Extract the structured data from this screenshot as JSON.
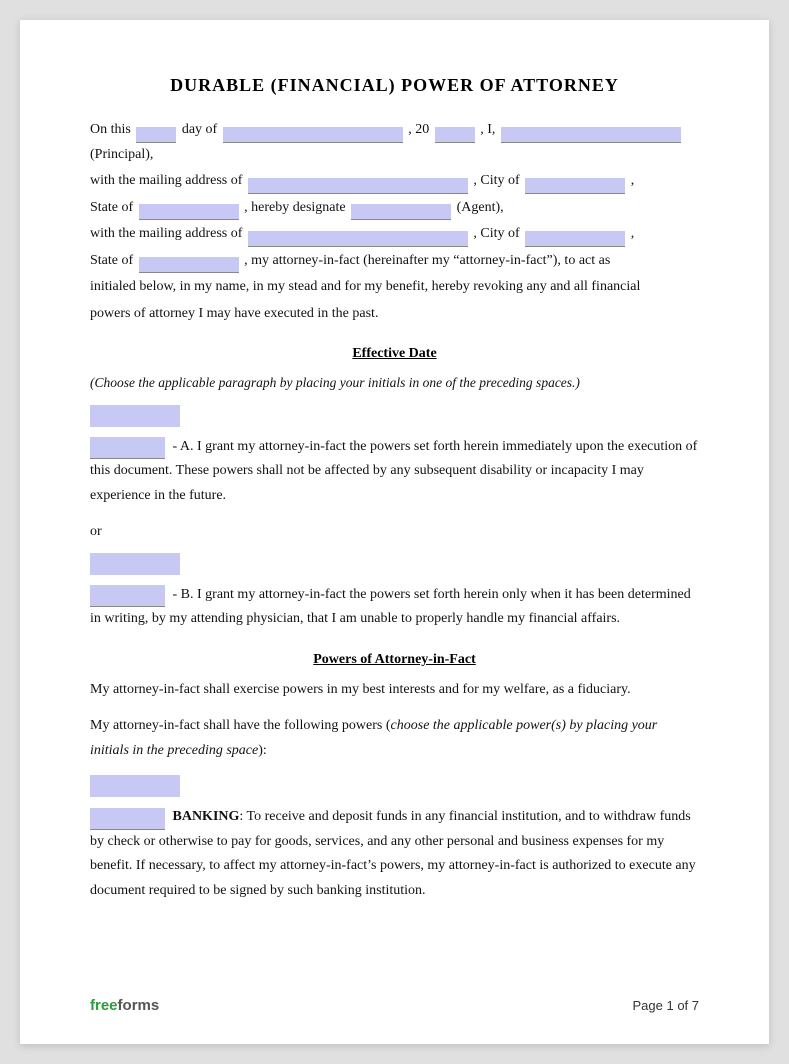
{
  "document": {
    "title": "DURABLE (FINANCIAL) POWER OF ATTORNEY",
    "intro": {
      "line1_prefix": "On this",
      "line1_mid": "day of",
      "line1_year_prefix": ", 20",
      "line1_i": ", I,",
      "line1_suffix": "(Principal),",
      "line2_prefix": "with the mailing address of",
      "line2_city": ", City of",
      "line3_state": "State of",
      "line3_mid": ", hereby designate",
      "line3_suffix": "(Agent),",
      "line4_prefix": "with the mailing address of",
      "line4_city": ", City of",
      "line5_state": "State of",
      "line5_suffix": ", my attorney-in-fact (hereinafter my “attorney-in-fact”), to act as",
      "line6": "initialed below, in my name, in my stead and for my benefit, hereby revoking any and all financial",
      "line7": "powers of attorney I may have executed in the past."
    },
    "effective_date": {
      "heading": "Effective Date",
      "instruction": "(Choose the applicable paragraph by placing your initials in one of the preceding spaces.)",
      "option_a_label": "- A.",
      "option_a_text": "I grant my attorney-in-fact the powers set forth herein immediately upon the execution of this document. These powers shall not be affected by any subsequent disability or incapacity I may experience in the future.",
      "or_text": "or",
      "option_b_label": "- B.",
      "option_b_text": "I grant my attorney-in-fact the powers set forth herein only when it has been determined in writing, by my attending physician, that I am unable to properly handle my financial affairs."
    },
    "powers_section": {
      "heading": "Powers of Attorney-in-Fact",
      "line1": "My attorney-in-fact shall exercise powers in my best interests and for my welfare, as a fiduciary.",
      "line2_prefix": "My attorney-in-fact shall have the following powers (",
      "line2_italic": "choose the applicable power(s) by placing your initials in the preceding space",
      "line2_suffix": "):",
      "banking_label": "BANKING",
      "banking_text": ": To receive and deposit funds in any financial institution, and to withdraw funds by check or otherwise to pay for goods, services, and any other personal and business expenses for my benefit.  If necessary, to affect my attorney-in-fact’s powers, my attorney-in-fact is authorized to execute any document required to be signed by such banking institution."
    },
    "footer": {
      "brand_free": "free",
      "brand_forms": "forms",
      "page_label": "Page 1 of 7"
    }
  }
}
